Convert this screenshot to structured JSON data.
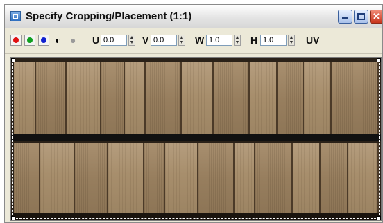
{
  "window": {
    "title": "Specify Cropping/Placement (1:1)"
  },
  "toolbar": {
    "channels": [
      {
        "name": "red-channel",
        "color": "#e01010"
      },
      {
        "name": "green-channel",
        "color": "#10a020"
      },
      {
        "name": "blue-channel",
        "color": "#1020d0"
      }
    ],
    "u_label": "U",
    "u_value": "0.0",
    "v_label": "V",
    "v_value": "0.0",
    "w_label": "W",
    "w_value": "1.0",
    "h_label": "H",
    "h_value": "1.0",
    "uv_label": "UV"
  },
  "canvas": {
    "texture": "wood-shingles"
  },
  "colors": {
    "title_bar": "#e4e4e4",
    "toolbar": "#ece9d8",
    "close_button": "#c8351d"
  }
}
